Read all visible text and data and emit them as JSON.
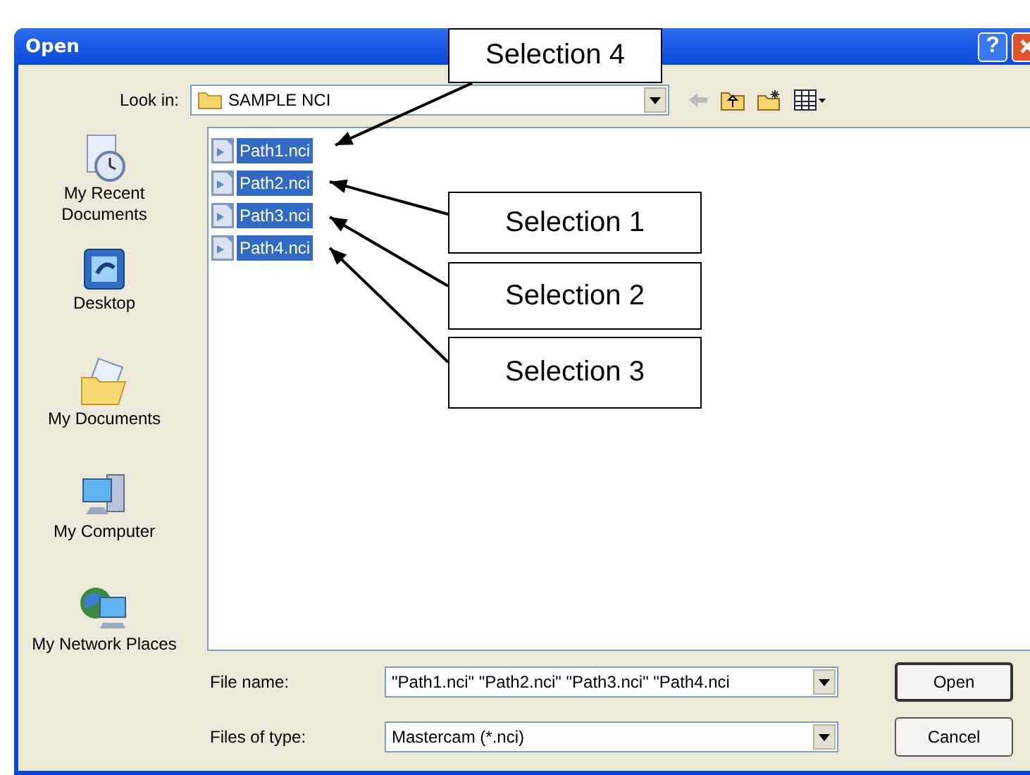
{
  "window": {
    "title": "Open",
    "help_button": "?"
  },
  "look_in": {
    "label": "Look in:",
    "value": "SAMPLE NCI"
  },
  "places": [
    {
      "label": "My Recent Documents",
      "kind": "recent"
    },
    {
      "label": "Desktop",
      "kind": "desktop"
    },
    {
      "label": "My Documents",
      "kind": "documents"
    },
    {
      "label": "My Computer",
      "kind": "computer"
    },
    {
      "label": "My Network Places",
      "kind": "network"
    }
  ],
  "files": [
    {
      "name": "Path1.nci",
      "selected": true
    },
    {
      "name": "Path2.nci",
      "selected": true
    },
    {
      "name": "Path3.nci",
      "selected": true
    },
    {
      "name": "Path4.nci",
      "selected": true
    }
  ],
  "file_name": {
    "label": "File name:",
    "value": "\"Path1.nci\" \"Path2.nci\" \"Path3.nci\" \"Path4.nci"
  },
  "file_type": {
    "label": "Files of type:",
    "value": "Mastercam (*.nci)"
  },
  "buttons": [
    "Open",
    "Cancel"
  ],
  "callouts": [
    {
      "label": "Selection 4"
    },
    {
      "label": "Selection 1"
    },
    {
      "label": "Selection 2"
    },
    {
      "label": "Selection 3"
    }
  ]
}
